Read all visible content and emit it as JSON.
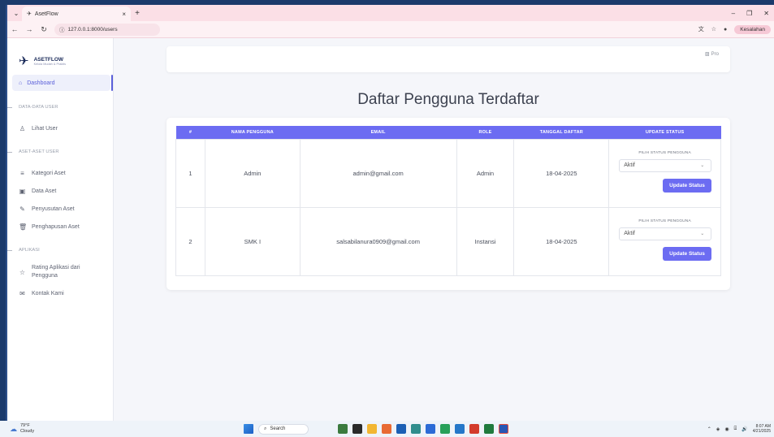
{
  "browser": {
    "tab_title": "AsetFlow",
    "tab_close": "×",
    "new_tab": "+",
    "url": "127.0.0.1:8000/users",
    "profile_label": "Kesalahan"
  },
  "sidebar": {
    "brand_name": "ASETFLOW",
    "brand_tagline": "Kelola Mudah & Praktis",
    "active_item": "Dashboard",
    "sections": [
      {
        "title": "DATA-DATA USER",
        "items": [
          "Lihat User"
        ]
      },
      {
        "title": "ASET-ASET USER",
        "items": [
          "Kategori Aset",
          "Data Aset",
          "Penyusutan Aset",
          "Penghapusan Aset"
        ]
      },
      {
        "title": "APLIKASI",
        "items": [
          "Rating Aplikasi dari Pengguna",
          "Kontak Kami"
        ]
      }
    ]
  },
  "main": {
    "avatar_alt": "Pro",
    "page_title": "Daftar Pengguna Terdaftar",
    "table": {
      "headers": [
        "#",
        "NAMA PENGGUNA",
        "EMAIL",
        "ROLE",
        "TANGGAL DAFTAR",
        "UPDATE STATUS"
      ],
      "status_label": "PILIH STATUS PENGGUNA",
      "update_button": "Update Status",
      "rows": [
        {
          "no": "1",
          "name": "Admin",
          "email": "admin@gmail.com",
          "role": "Admin",
          "date": "18-04-2025",
          "status": "Aktif"
        },
        {
          "no": "2",
          "name": "SMK I",
          "email": "salsabilanura0909@gmail.com",
          "role": "Instansi",
          "date": "18-04-2025",
          "status": "Aktif"
        }
      ]
    }
  },
  "taskbar": {
    "temperature": "79°F",
    "weather": "Cloudy",
    "search": "Search",
    "time": "8:07 AM",
    "date": "4/21/2025"
  },
  "colors": {
    "accent": "#6c6cf2",
    "tab_strip": "#fbdfe6",
    "sidebar_active_bg": "#eef0fb"
  }
}
